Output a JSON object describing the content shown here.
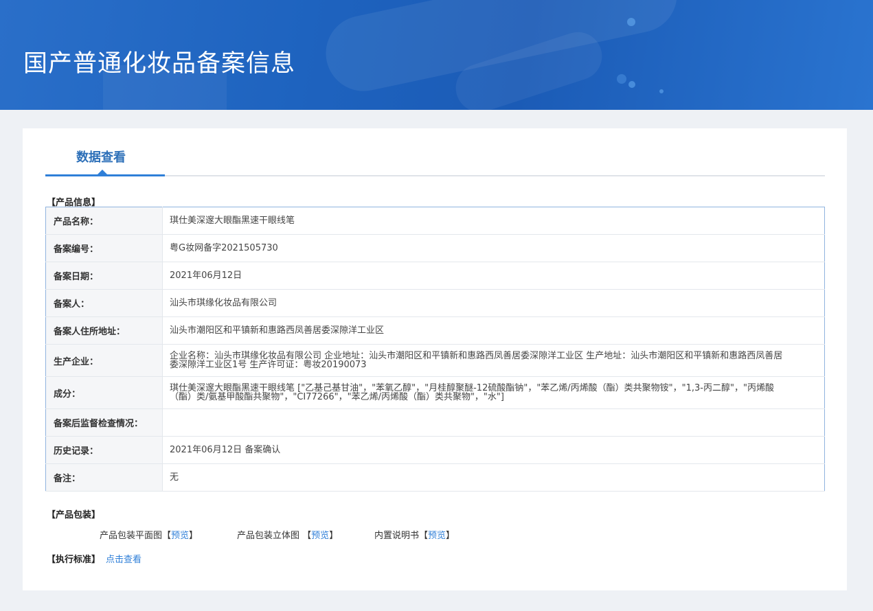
{
  "header": {
    "title": "国产普通化妆品备案信息"
  },
  "tab": {
    "label": "数据查看"
  },
  "sections": {
    "product_info": "【产品信息】",
    "product_package": "【产品包装】",
    "standard": "【执行标准】"
  },
  "product": {
    "rows": [
      {
        "key": "产品名称：",
        "value": "琪仕美深邃大眼酯黑速干眼线笔"
      },
      {
        "key": "备案编号：",
        "value": "粤G妆网备字2021505730"
      },
      {
        "key": "备案日期：",
        "value": "2021年06月12日"
      },
      {
        "key": "备案人：",
        "value": "汕头市琪缘化妆品有限公司"
      },
      {
        "key": "备案人住所地址：",
        "value": "汕头市潮阳区和平镇新和惠路西凤善居委深隙洋工业区"
      },
      {
        "key": "生产企业：",
        "value": "企业名称：汕头市琪缘化妆品有限公司 企业地址：汕头市潮阳区和平镇新和惠路西凤善居委深隙洋工业区 生产地址：汕头市潮阳区和平镇新和惠路西凤善居委深隙洋工业区1号 生产许可证：粤妆20190073"
      },
      {
        "key": "成分：",
        "value": "琪仕美深邃大眼酯黑速干眼线笔 [\"乙基己基甘油\"，\"苯氧乙醇\"，\"月桂醇聚醚-12硫酸酯钠\"，\"苯乙烯/丙烯酸（酯）类共聚物铵\"，\"1,3-丙二醇\"，\"丙烯酸（酯）类/氨基甲酸酯共聚物\"，\"CI77266\"，\"苯乙烯/丙烯酸（酯）类共聚物\"，\"水\"]"
      },
      {
        "key": "备案后监督检查情况：",
        "value": ""
      },
      {
        "key": "历史记录：",
        "value": "2021年06月12日 备案确认"
      },
      {
        "key": "备注：",
        "value": "无"
      }
    ]
  },
  "package": {
    "flat_label": "产品包装平面图",
    "solid_label": "产品包装立体图",
    "manual_label": "内置说明书",
    "preview_label": "预览",
    "bracket_open": "【",
    "bracket_close": "】"
  },
  "standard": {
    "link_label": "点击查看"
  },
  "colors": {
    "banner": "#1e63bf",
    "accent": "#2f7fd8",
    "tab_text": "#2c6fb8",
    "table_border": "#8fb3df",
    "page_bg": "#eef1f5"
  }
}
